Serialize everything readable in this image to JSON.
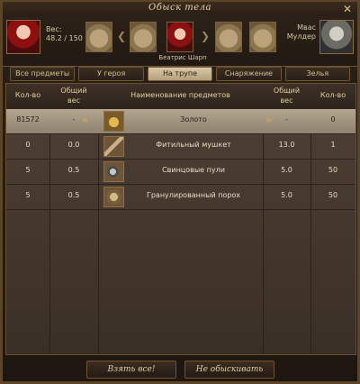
{
  "window": {
    "title": "Обыск тела"
  },
  "header": {
    "weight_label": "Вес:",
    "weight_value": "48.2 / 150",
    "character_name": "Беатрис Шарп",
    "target_name_line1": "Мвас",
    "target_name_line2": "Мулдер"
  },
  "tabs": [
    {
      "label": "Все предметы",
      "active": false
    },
    {
      "label": "У героя",
      "active": false
    },
    {
      "label": "На трупе",
      "active": true
    },
    {
      "label": "Снаряжение",
      "active": false
    },
    {
      "label": "Зелья",
      "active": false
    }
  ],
  "table": {
    "headers": {
      "qty_left": "Кол-во",
      "weight_left_1": "Общий",
      "weight_left_2": "вес",
      "name": "Наименование предметов",
      "weight_right_1": "Общий",
      "weight_right_2": "вес",
      "qty_right": "Кол-во"
    },
    "rows": [
      {
        "qty_left": "81572",
        "weight_left": "-",
        "name": "Золото",
        "weight_right": "-",
        "qty_right": "0",
        "icon": "gold-icon",
        "highlight": true
      },
      {
        "qty_left": "0",
        "weight_left": "0.0",
        "name": "Фитильный мушкет",
        "weight_right": "13.0",
        "qty_right": "1",
        "icon": "musket-icon",
        "highlight": false
      },
      {
        "qty_left": "5",
        "weight_left": "0.5",
        "name": "Свинцовые пули",
        "weight_right": "5.0",
        "qty_right": "50",
        "icon": "bullets-icon",
        "highlight": false
      },
      {
        "qty_left": "5",
        "weight_left": "0.5",
        "name": "Гранулированный порох",
        "weight_right": "5.0",
        "qty_right": "50",
        "icon": "gunpowder-icon",
        "highlight": false
      }
    ]
  },
  "buttons": {
    "take_all": "Взять все!",
    "dont_search": "Не обыскивать"
  },
  "colors": {
    "frame": "#5c4427",
    "highlight_row": "#b3a792",
    "text": "#e7dcc5",
    "accent": "#d2aa4d"
  }
}
